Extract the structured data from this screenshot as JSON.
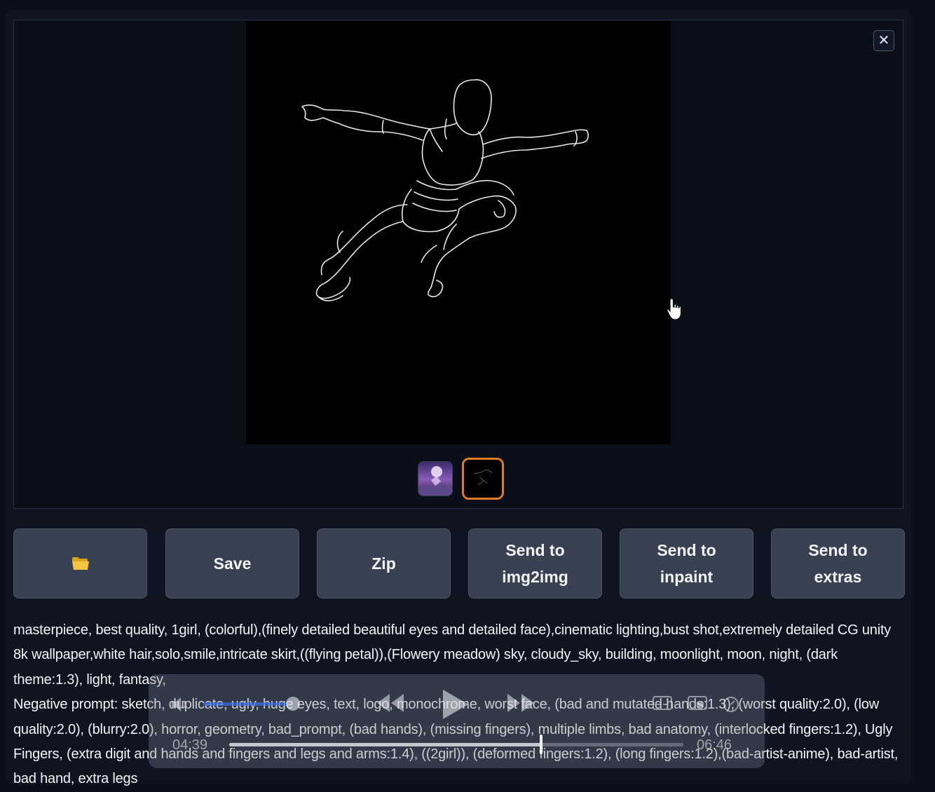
{
  "gallery": {
    "close_label": "✕",
    "thumbnails": [
      "generated-image",
      "canny-preview"
    ],
    "selected_thumbnail": 1
  },
  "actions": {
    "folder_icon": "folder-icon",
    "save_label": "Save",
    "zip_label": "Zip",
    "img2img_label": "Send to\nimg2img",
    "inpaint_label": "Send to\ninpaint",
    "extras_label": "Send to\nextras"
  },
  "generation_info": {
    "prompt": "masterpiece, best quality, 1girl, (colorful),(finely detailed beautiful eyes and detailed face),cinematic lighting,bust shot,extremely detailed CG unity 8k wallpaper,white hair,solo,smile,intricate skirt,((flying petal)),(Flowery meadow) sky, cloudy_sky, building, moonlight, moon, night, (dark theme:1.3), light, fantasy,",
    "negative_prompt": "Negative prompt: sketch, duplicate, ugly, huge eyes, text, logo, monochrome, worst face, (bad and mutated hands:1.3), (worst quality:2.0), (low quality:2.0), (blurry:2.0), horror, geometry, bad_prompt, (bad hands), (missing fingers), multiple limbs, bad anatomy, (interlocked fingers:1.2), Ugly Fingers, (extra digit and hands and fingers and legs and arms:1.4), ((2girl)), (deformed fingers:1.2), (long fingers:1.2),(bad-artist-anime), bad-artist, bad hand, extra legs"
  },
  "video_player": {
    "current_time": "04:39",
    "duration": "06:46",
    "progress": 0.687
  }
}
